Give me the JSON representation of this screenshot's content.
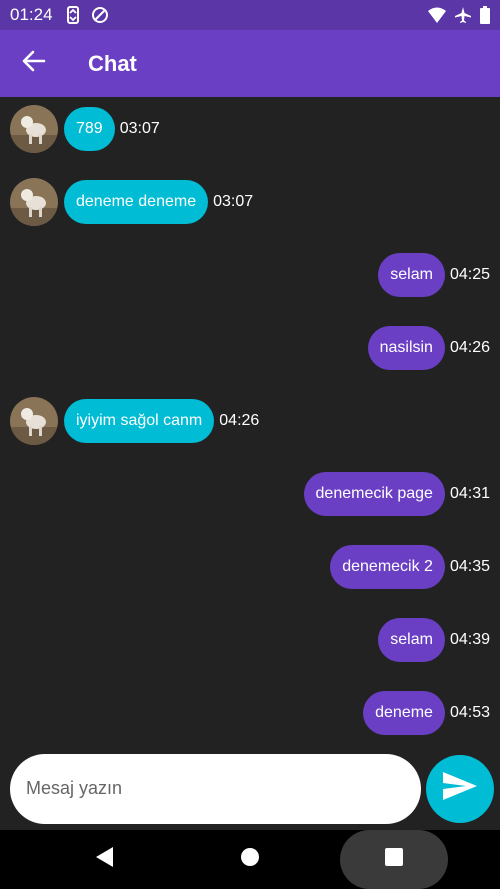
{
  "status_bar": {
    "time": "01:24",
    "icons_left": [
      "sync-icon",
      "data-saver-icon"
    ],
    "icons_right": [
      "wifi-icon",
      "airplane-mode-icon",
      "battery-icon"
    ]
  },
  "app_bar": {
    "title": "Chat",
    "back_icon": "arrow-left-icon"
  },
  "messages": [
    {
      "direction": "incoming",
      "text": "789",
      "time": "03:07"
    },
    {
      "direction": "incoming",
      "text": "deneme deneme",
      "time": "03:07"
    },
    {
      "direction": "outgoing",
      "text": "selam",
      "time": "04:25"
    },
    {
      "direction": "outgoing",
      "text": "nasilsin",
      "time": "04:26"
    },
    {
      "direction": "incoming",
      "text": "iyiyim sağol canm",
      "time": "04:26"
    },
    {
      "direction": "outgoing",
      "text": "denemecik page",
      "time": "04:31"
    },
    {
      "direction": "outgoing",
      "text": "denemecik 2",
      "time": "04:35"
    },
    {
      "direction": "outgoing",
      "text": "selam",
      "time": "04:39"
    },
    {
      "direction": "outgoing",
      "text": "deneme",
      "time": "04:53"
    }
  ],
  "composer": {
    "placeholder": "Mesaj yazın",
    "value": "",
    "send_icon": "send-icon"
  },
  "colors": {
    "status_bar": "#5a36a6",
    "app_bar": "#6a3fc4",
    "background": "#222222",
    "incoming_bubble": "#00bcd4",
    "outgoing_bubble": "#6a3fc4",
    "send_button": "#00bcd4"
  },
  "nav_bar": {
    "icons": [
      "nav-back-icon",
      "nav-home-icon",
      "nav-recents-icon"
    ]
  }
}
